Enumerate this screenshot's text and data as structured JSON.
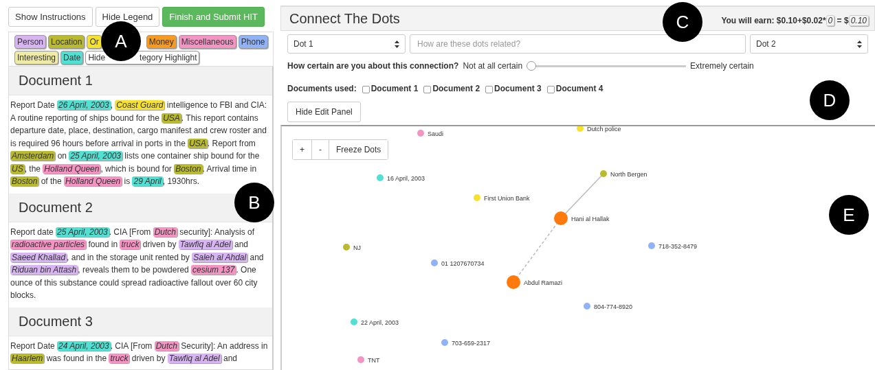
{
  "toolbar": {
    "buttons": [
      {
        "label": "Show Instructions",
        "kind": "plain"
      },
      {
        "label": "Hide Legend",
        "kind": "plain"
      },
      {
        "label": "Finish and Submit HIT",
        "kind": "primary"
      }
    ]
  },
  "legend": {
    "categories": [
      {
        "label": "Person",
        "kind": "person",
        "color": "#d8b4f2"
      },
      {
        "label": "Location",
        "kind": "location",
        "color": "#b9bb2c"
      },
      {
        "label": "Or",
        "kind": "organization",
        "color": "#f6e12c"
      },
      {
        "label": "Money",
        "kind": "money",
        "color": "#f79a1e"
      },
      {
        "label": "Miscellaneous",
        "kind": "miscellaneous",
        "color": "#f394c3"
      },
      {
        "label": "Phone",
        "kind": "phone",
        "color": "#90b3f7"
      },
      {
        "label": "Interesting",
        "kind": "interesting",
        "color": "#eeeba6"
      },
      {
        "label": "Date",
        "kind": "date",
        "color": "#52e0d2"
      }
    ],
    "hide_button": {
      "label_start": "Hide",
      "label_end": "tegory Highlight"
    }
  },
  "documents": [
    {
      "title": "Document 1",
      "segments": [
        {
          "text": "Report Date "
        },
        {
          "text": "26 April, 2003",
          "kind": "date"
        },
        {
          "text": ", "
        },
        {
          "text": "Coast Guard",
          "kind": "organization"
        },
        {
          "text": " intelligence to FBI and CIA: A routine reporting of ships bound for the "
        },
        {
          "text": "USA",
          "kind": "location"
        },
        {
          "text": ". This report contains departure date, place, destination, cargo manifest and crew roster and is required 96 hours before arrival in ports in the "
        },
        {
          "text": "USA",
          "kind": "location"
        },
        {
          "text": ". Report from "
        },
        {
          "text": "Amsterdam",
          "kind": "location"
        },
        {
          "text": " on "
        },
        {
          "text": "25 April, 2003",
          "kind": "date"
        },
        {
          "text": " lists one container ship bound for the "
        },
        {
          "text": "US",
          "kind": "location"
        },
        {
          "text": ", the "
        },
        {
          "text": "Holland Queen",
          "kind": "miscellaneous"
        },
        {
          "text": ", which is bound for "
        },
        {
          "text": "Boston",
          "kind": "location"
        },
        {
          "text": ". Arrival time in "
        },
        {
          "text": "Boston",
          "kind": "location"
        },
        {
          "text": " of the "
        },
        {
          "text": "Holland Queen",
          "kind": "miscellaneous"
        },
        {
          "text": " is "
        },
        {
          "text": "29 April",
          "kind": "date"
        },
        {
          "text": ", 1930hrs."
        }
      ]
    },
    {
      "title": "Document 2",
      "segments": [
        {
          "text": "Report date "
        },
        {
          "text": "25 April, 2003",
          "kind": "date"
        },
        {
          "text": ". CIA [From "
        },
        {
          "text": "Dutch",
          "kind": "miscellaneous"
        },
        {
          "text": " security]: Analysis of "
        },
        {
          "text": "radioactive particles",
          "kind": "miscellaneous"
        },
        {
          "text": " found in "
        },
        {
          "text": "truck",
          "kind": "miscellaneous"
        },
        {
          "text": " driven by "
        },
        {
          "text": "Tawfiq al Adel",
          "kind": "person"
        },
        {
          "text": " and "
        },
        {
          "text": "Saeed Khallad",
          "kind": "person"
        },
        {
          "text": ", and in the storage unit rented by "
        },
        {
          "text": "Saleh al Ahdal",
          "kind": "person"
        },
        {
          "text": " and "
        },
        {
          "text": "Riduan bin Attash",
          "kind": "person"
        },
        {
          "text": ", reveals them to be powdered "
        },
        {
          "text": "cesium 137",
          "kind": "miscellaneous"
        },
        {
          "text": ". One ounce of this substance could spread radioactive fallout over 60 city blocks."
        }
      ]
    },
    {
      "title": "Document 3",
      "segments": [
        {
          "text": "Report Date "
        },
        {
          "text": "24 April, 2003",
          "kind": "date"
        },
        {
          "text": ". CIA [From "
        },
        {
          "text": "Dutch",
          "kind": "miscellaneous"
        },
        {
          "text": " Security]: An address in "
        },
        {
          "text": "Haarlem",
          "kind": "location"
        },
        {
          "text": " was found in the "
        },
        {
          "text": "truck",
          "kind": "miscellaneous"
        },
        {
          "text": " driven by "
        },
        {
          "text": "Tawfiq al Adel",
          "kind": "person"
        },
        {
          "text": " and"
        }
      ]
    }
  ],
  "panel": {
    "title": "Connect The Dots",
    "earnings": {
      "label": "You will earn: $0.10+$0.02*",
      "count": "0",
      "equals": " = $",
      "total": "0.10"
    },
    "dot_1": {
      "value": "Dot 1"
    },
    "relation": {
      "placeholder": "How are these dots related?"
    },
    "dot_2": {
      "value": "Dot 2"
    },
    "certainty": {
      "question": "How certain are you about this connection?",
      "min_label": "Not at all certain",
      "max_label": "Extremely certain",
      "level": 0
    },
    "documents_used": {
      "label": "Documents used:",
      "items": [
        {
          "label": "Document 1",
          "checked": false
        },
        {
          "label": "Document 2",
          "checked": false
        },
        {
          "label": "Document 3",
          "checked": false
        },
        {
          "label": "Document 4",
          "checked": false
        }
      ]
    },
    "hide_edit_button": "Hide Edit Panel"
  },
  "graph": {
    "controls": [
      "+",
      "-",
      "Freeze Dots"
    ],
    "nodes": [
      {
        "label": "Saudi",
        "color": "#f394c3",
        "selected": false
      },
      {
        "label": "Dutch police",
        "color": "#f6e12c",
        "selected": false
      },
      {
        "label": "16 April, 2003",
        "color": "#52e0d2",
        "selected": false
      },
      {
        "label": "First Union Bank",
        "color": "#f6e12c",
        "selected": false
      },
      {
        "label": "North Bergen",
        "color": "#b9bb2c",
        "selected": false,
        "linked": true,
        "dashed": false
      },
      {
        "label": "Hani al Hallak",
        "color": "#ff7a0a",
        "selected": true,
        "linked": true,
        "dashed": true
      },
      {
        "label": "Abdul Ramazi",
        "color": "#ff7a0a",
        "selected": true
      },
      {
        "label": "NJ",
        "color": "#b9bb2c",
        "selected": false
      },
      {
        "label": "718-352-8479",
        "color": "#90b3f7",
        "selected": false
      },
      {
        "label": "01 1207670734",
        "color": "#90b3f7",
        "selected": false
      },
      {
        "label": "804-774-8920",
        "color": "#90b3f7",
        "selected": false
      },
      {
        "label": "22 April, 2003",
        "color": "#52e0d2",
        "selected": false
      },
      {
        "label": "703-659-2317",
        "color": "#90b3f7",
        "selected": false
      },
      {
        "label": "TNT",
        "color": "#f394c3",
        "selected": false
      }
    ]
  },
  "callouts": [
    {
      "label": "A"
    },
    {
      "label": "B"
    },
    {
      "label": "C"
    },
    {
      "label": "D"
    },
    {
      "label": "E"
    }
  ]
}
